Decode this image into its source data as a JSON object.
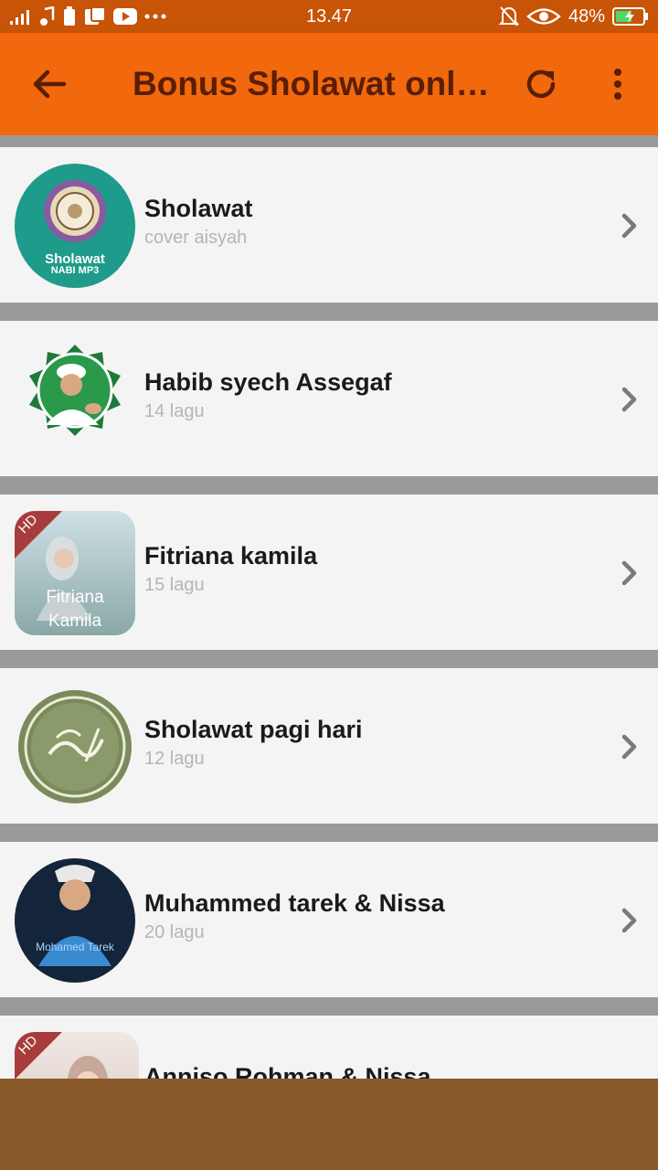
{
  "status_bar": {
    "time": "13.47",
    "battery": "48%",
    "colors": {
      "bar": "#c75407"
    }
  },
  "app_bar": {
    "title": "Bonus Sholawat online",
    "colors": {
      "background": "#f2680c",
      "title": "#5a1e05"
    }
  },
  "list": {
    "items": [
      {
        "name": "Sholawat",
        "subtitle": "cover aisyah",
        "thumb_icon": "sholawat-nabi-mp3-logo",
        "thumb_caption_1": "Sholawat",
        "thumb_caption_2": "NABI MP3"
      },
      {
        "name": "Habib syech Assegaf",
        "subtitle": "14 lagu",
        "thumb_icon": "habib-syech-portrait"
      },
      {
        "name": "Fitriana kamila",
        "subtitle": "15 lagu",
        "thumb_icon": "fitriana-kamila-cover",
        "badge": "HD",
        "thumb_caption_1": "Fitriana",
        "thumb_caption_2": "Kamila"
      },
      {
        "name": "Sholawat pagi hari",
        "subtitle": "12 lagu",
        "thumb_icon": "muhammad-calligraphy-seal"
      },
      {
        "name": "Muhammed tarek & Nissa",
        "subtitle": "20 lagu",
        "thumb_icon": "mohamed-tarek-portrait",
        "thumb_caption_1": "Mohamed Tarek"
      },
      {
        "name": "Anniso Rohman & Nissa",
        "subtitle": "",
        "thumb_icon": "anniso-cover",
        "badge": "HD"
      }
    ]
  }
}
